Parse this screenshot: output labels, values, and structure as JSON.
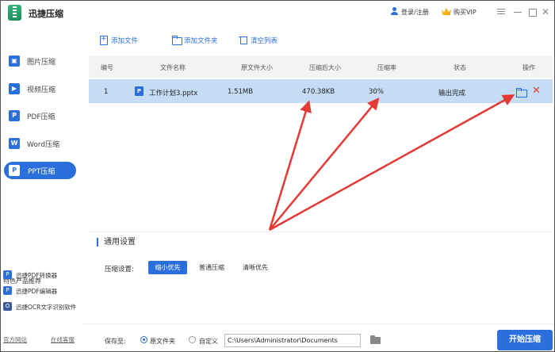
{
  "app": {
    "title": "迅捷压缩",
    "login_label": "登录/注册",
    "vip_label": "购买VIP",
    "colors": {
      "accent": "#2a6fdb",
      "selected_row": "#c6dcf5",
      "delete": "#e53935",
      "arrow": "#e53935"
    }
  },
  "sidebar": {
    "items": [
      {
        "label": "图片压缩",
        "icon": "image-icon"
      },
      {
        "label": "视频压缩",
        "icon": "video-icon"
      },
      {
        "label": "PDF压缩",
        "icon": "pdf-icon"
      },
      {
        "label": "Word压缩",
        "icon": "word-icon"
      },
      {
        "label": "PPT压缩",
        "icon": "ppt-icon",
        "active": true
      }
    ],
    "promo_title": "特色产品推荐",
    "promo_items": [
      {
        "label": "迅捷PDF转换器",
        "icon": "pdf-converter-icon"
      },
      {
        "label": "迅捷PDF编辑器",
        "icon": "pdf-editor-icon"
      },
      {
        "label": "迅捷OCR文字识别软件",
        "icon": "ocr-icon"
      }
    ],
    "footer_links": [
      "官方网站",
      "在线客服"
    ]
  },
  "toolbar": {
    "add_file": "添加文件",
    "add_folder": "添加文件夹",
    "clear_list": "清空列表"
  },
  "table": {
    "headers": [
      "编号",
      "文件名称",
      "原文件大小",
      "压缩后大小",
      "压缩率",
      "状态",
      "操作"
    ],
    "rows": [
      {
        "index": "1",
        "name": "工作计划3.pptx",
        "original_size": "1.51MB",
        "compressed_size": "470.38KB",
        "ratio": "30%",
        "status": "输出完成"
      }
    ]
  },
  "settings": {
    "title": "通用设置",
    "mode_label": "压缩设置:",
    "options": [
      "缩小优先",
      "普通压缩",
      "清晰优先"
    ],
    "selected": "缩小优先"
  },
  "footer": {
    "save_label": "保存至:",
    "option_original": "原文件夹",
    "option_custom": "自定义",
    "path": "C:\\Users\\Administrator\\Documents",
    "start_button": "开始压缩"
  }
}
